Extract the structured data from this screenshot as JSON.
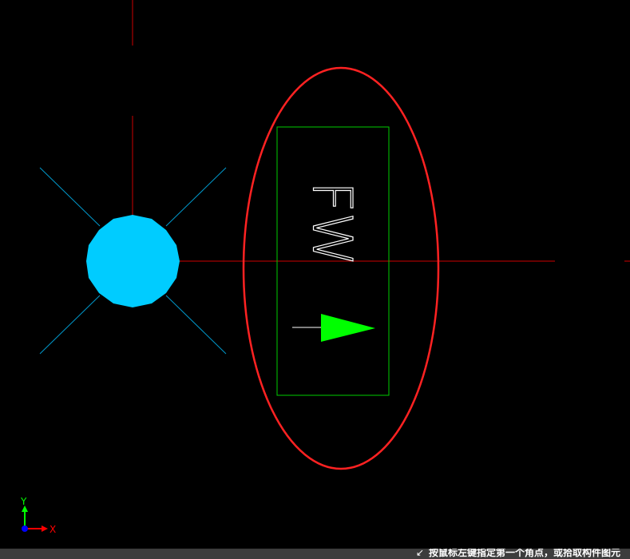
{
  "canvas": {
    "background": "#000000",
    "crosshair_color": "#cc0000",
    "ucs": {
      "y_label": "Y",
      "x_label": "X",
      "y_color": "#00ff00",
      "x_color": "#ff0000",
      "origin_color": "#0000ff"
    }
  },
  "symbols": {
    "node": {
      "name": "cyan-node",
      "fill": "#00ccff",
      "ray_color": "#0099cc"
    },
    "device": {
      "label": "FW",
      "box_color": "#00cc00",
      "ellipse_color": "#ff2222",
      "arrow_color": "#00ff00"
    }
  },
  "status_bar": {
    "icon": "cursor-prompt-icon",
    "prompt": "按鼠标左键指定第一个角点，或拾取构件图元"
  }
}
